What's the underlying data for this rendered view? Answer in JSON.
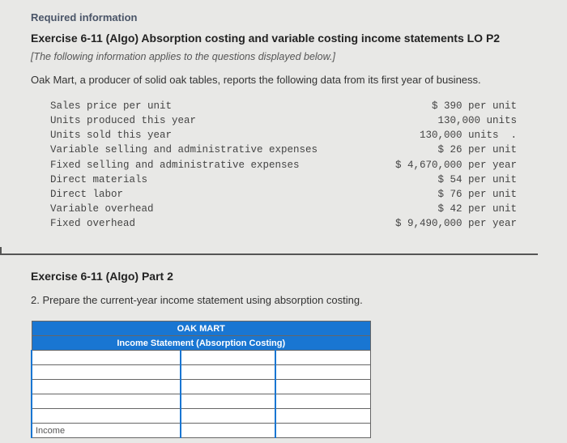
{
  "header": {
    "required_info": "Required information",
    "exercise_title": "Exercise 6-11 (Algo) Absorption costing and variable costing income statements LO P2",
    "applies_note": "[The following information applies to the questions displayed below.]",
    "intro": "Oak Mart, a producer of solid oak tables, reports the following data from its first year of business."
  },
  "data_rows": [
    {
      "label": "Sales price per unit",
      "value": "$ 390 per unit"
    },
    {
      "label": "Units produced this year",
      "value": "130,000 units"
    },
    {
      "label": "Units sold this year",
      "value": "130,000 units  ."
    },
    {
      "label": "Variable selling and administrative expenses",
      "value": "$ 26 per unit"
    },
    {
      "label": "Fixed selling and administrative expenses",
      "value": "$ 4,670,000 per year"
    },
    {
      "label": "Direct materials",
      "value": "$ 54 per unit"
    },
    {
      "label": "Direct labor",
      "value": "$ 76 per unit"
    },
    {
      "label": "Variable overhead",
      "value": "$ 42 per unit"
    },
    {
      "label": "Fixed overhead",
      "value": "$ 9,490,000 per year"
    }
  ],
  "part2": {
    "title": "Exercise 6-11 (Algo) Part 2",
    "instruction": "2. Prepare the current-year income statement using absorption costing."
  },
  "worksheet": {
    "company": "OAK MART",
    "statement_title": "Income Statement (Absorption Costing)",
    "income_label": "Income"
  }
}
